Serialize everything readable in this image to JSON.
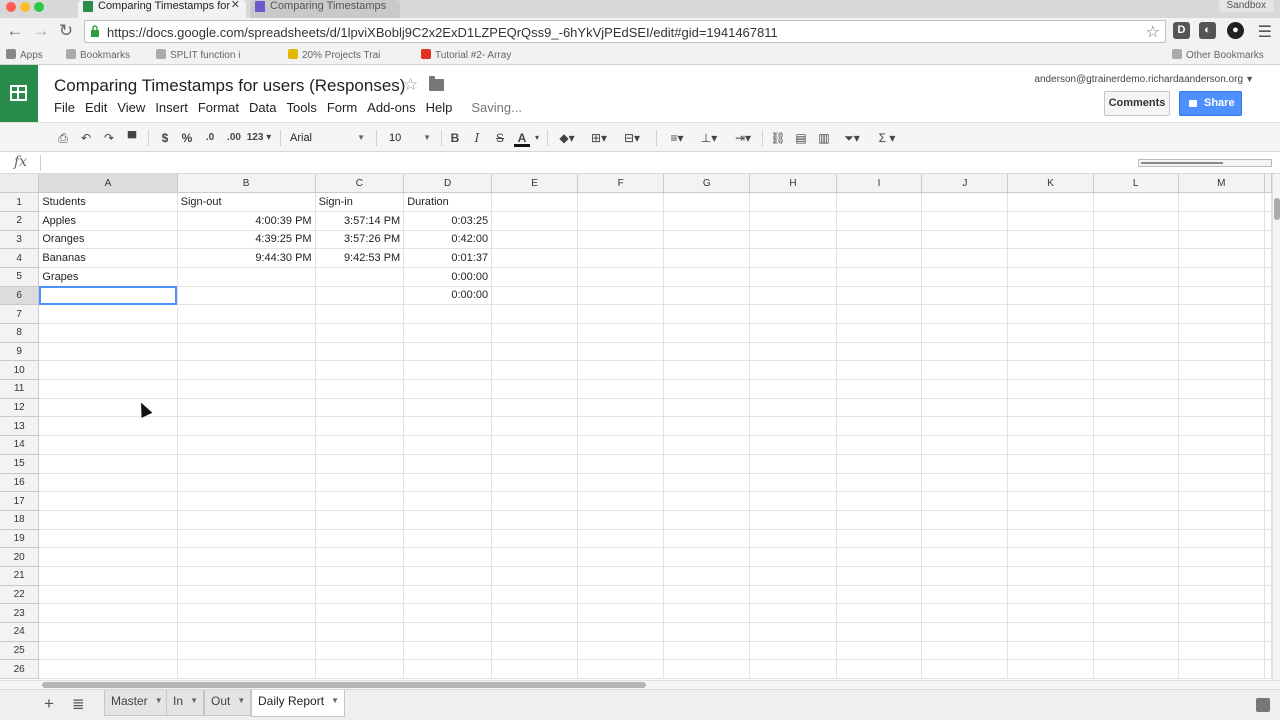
{
  "browser": {
    "tabs": [
      {
        "title": "Comparing Timestamps for",
        "close": "✕"
      },
      {
        "title": "Comparing Timestamps",
        "close": ""
      }
    ],
    "profile": "Sandbox",
    "url": "https://docs.google.com/spreadsheets/d/1lpviXBoblj9C2x2ExD1LZPEQrQss9_-6hYkVjPEdSEI/edit#gid=1941467811",
    "bookmarks": [
      "Apps",
      "Bookmarks",
      "SPLIT function i",
      "20% Projects Trai",
      "Tutorial #2- Array",
      "Other Bookmarks"
    ]
  },
  "docs": {
    "title": "Comparing Timestamps for users (Responses)",
    "menu": [
      "File",
      "Edit",
      "View",
      "Insert",
      "Format",
      "Data",
      "Tools",
      "Form",
      "Add-ons",
      "Help"
    ],
    "saving": "Saving...",
    "user_email": "anderson@gtrainerdemo.richardaanderson.org",
    "comments_label": "Comments",
    "share_label": "Share"
  },
  "toolbar": {
    "currency": "$",
    "percent": "%",
    "dec_decrease": ".0",
    "dec_increase": ".00",
    "more_formats": "123",
    "font": "Arial",
    "font_size": "10",
    "bold": "B",
    "italic": "I",
    "strike": "S",
    "text_color": "A",
    "sum": "Σ"
  },
  "formula_bar": {
    "fx_label": "fx",
    "value": ""
  },
  "grid": {
    "columns": [
      "A",
      "B",
      "C",
      "D",
      "E",
      "F",
      "G",
      "H",
      "I",
      "J",
      "K",
      "L",
      "M"
    ],
    "header_row": [
      "Students",
      "Sign-out",
      "Sign-in",
      "Duration"
    ],
    "rows": [
      [
        "Apples",
        "4:00:39 PM",
        "3:57:14 PM",
        "0:03:25"
      ],
      [
        "Oranges",
        "4:39:25 PM",
        "3:57:26 PM",
        "0:42:00"
      ],
      [
        "Bananas",
        "9:44:30 PM",
        "9:42:53 PM",
        "0:01:37"
      ],
      [
        "Grapes",
        "",
        "",
        "0:00:00"
      ],
      [
        "",
        "",
        "",
        "0:00:00"
      ]
    ],
    "row_count": 26,
    "selected_cell": "A6"
  },
  "sheets": {
    "add_label": "+",
    "tabs": [
      "Master",
      "In",
      "Out",
      "Daily Report"
    ],
    "active": "Daily Report"
  },
  "colors": {
    "sheets_green": "#2a8c4a",
    "share_blue": "#4d90fe",
    "selection_blue": "#4d90fe"
  }
}
